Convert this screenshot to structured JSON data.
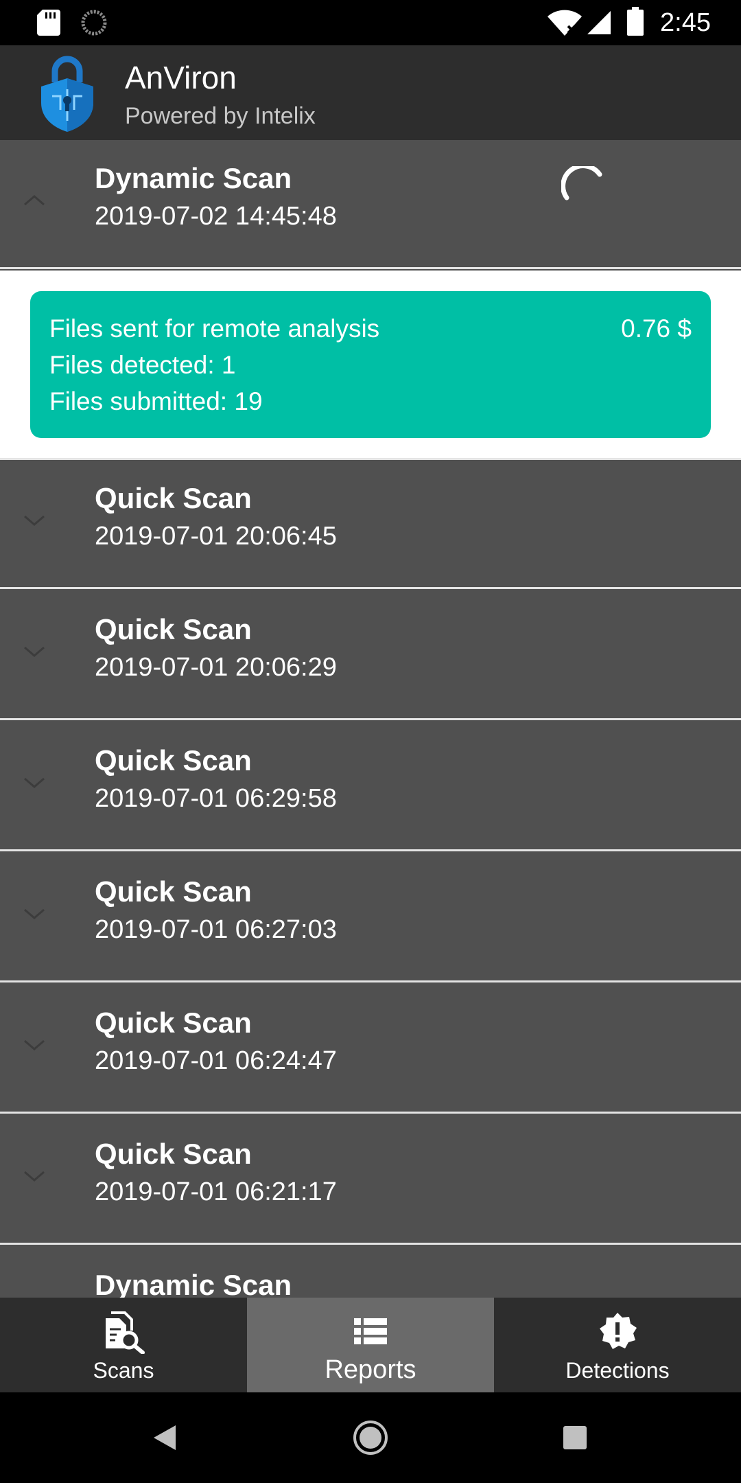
{
  "status_bar": {
    "time": "2:45"
  },
  "app": {
    "title": "AnViron",
    "subtitle": "Powered by Intelix"
  },
  "expanded_scan": {
    "name": "Dynamic Scan",
    "date": "2019-07-02 14:45:48",
    "summary": {
      "line1": "Files sent for remote analysis",
      "cost": "0.76 $",
      "line2": "Files detected: 1",
      "line3": "Files submitted: 19"
    }
  },
  "scans": [
    {
      "name": "Quick Scan",
      "date": "2019-07-01 20:06:45"
    },
    {
      "name": "Quick Scan",
      "date": "2019-07-01 20:06:29"
    },
    {
      "name": "Quick Scan",
      "date": "2019-07-01 06:29:58"
    },
    {
      "name": "Quick Scan",
      "date": "2019-07-01 06:27:03"
    },
    {
      "name": "Quick Scan",
      "date": "2019-07-01 06:24:47"
    },
    {
      "name": "Quick Scan",
      "date": "2019-07-01 06:21:17"
    },
    {
      "name": "Dynamic Scan",
      "date": ""
    }
  ],
  "bottom_nav": [
    {
      "label": "Scans",
      "icon": "scan-document-icon",
      "active": false
    },
    {
      "label": "Reports",
      "icon": "list-icon",
      "active": true
    },
    {
      "label": "Detections",
      "icon": "alert-badge-icon",
      "active": false
    }
  ],
  "colors": {
    "accent": "#00bfa5",
    "list_bg": "#505050",
    "bar_bg": "#2d2d2d",
    "active_tab": "#6a6a6a"
  }
}
